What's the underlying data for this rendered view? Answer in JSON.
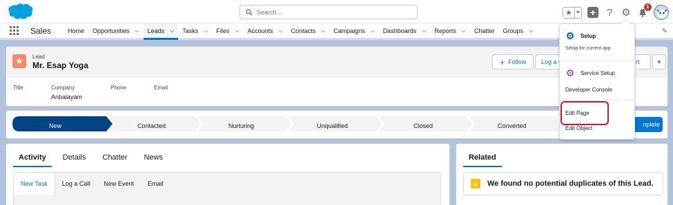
{
  "header": {
    "search_placeholder": "Search...",
    "notification_count": "1"
  },
  "nav": {
    "app_name": "Sales",
    "items": [
      {
        "label": "Home",
        "has_menu": false
      },
      {
        "label": "Opportunities",
        "has_menu": true
      },
      {
        "label": "Leads",
        "has_menu": true,
        "active": true
      },
      {
        "label": "Tasks",
        "has_menu": true
      },
      {
        "label": "Files",
        "has_menu": true
      },
      {
        "label": "Accounts",
        "has_menu": true
      },
      {
        "label": "Contacts",
        "has_menu": true
      },
      {
        "label": "Campaigns",
        "has_menu": true
      },
      {
        "label": "Dashboards",
        "has_menu": true
      },
      {
        "label": "Reports",
        "has_menu": true
      },
      {
        "label": "Chatter",
        "has_menu": false
      },
      {
        "label": "Groups",
        "has_menu": true
      }
    ]
  },
  "record": {
    "type_label": "Lead",
    "name": "Mr. Esap Yoga",
    "follow_label": "Follow",
    "log_a_call_label": "Log a C",
    "convert_label_fragment": "rt",
    "fields": {
      "title_label": "Title",
      "company_label": "Company",
      "company_value": "Anbalayam",
      "phone_label": "Phone",
      "email_label": "Email"
    }
  },
  "path": {
    "stages": [
      "New",
      "Contacted",
      "Nurturing",
      "Unqualified",
      "Closed",
      "Converted"
    ],
    "current": "New",
    "complete_label": "nplete"
  },
  "activity": {
    "tabs": [
      "Activity",
      "Details",
      "Chatter",
      "News"
    ],
    "active_tab": "Activity",
    "subtabs": [
      "New Task",
      "Log a Call",
      "New Event",
      "Email"
    ],
    "active_subtab": "New Task"
  },
  "related": {
    "tab_label": "Related",
    "duplicate_message": "We found no potential duplicates of this Lead."
  },
  "setup_menu": {
    "setup_label": "Setup",
    "setup_sub": "Setup for current app",
    "service_setup_label": "Service Setup",
    "developer_console_label": "Developer Console",
    "edit_page_label": "Edit Page",
    "edit_object_label": "Edit Object"
  },
  "colors": {
    "brand_blue": "#0176d3",
    "lead_icon": "#f88962",
    "path_current": "#014486",
    "highlight_box": "#d7171f"
  }
}
